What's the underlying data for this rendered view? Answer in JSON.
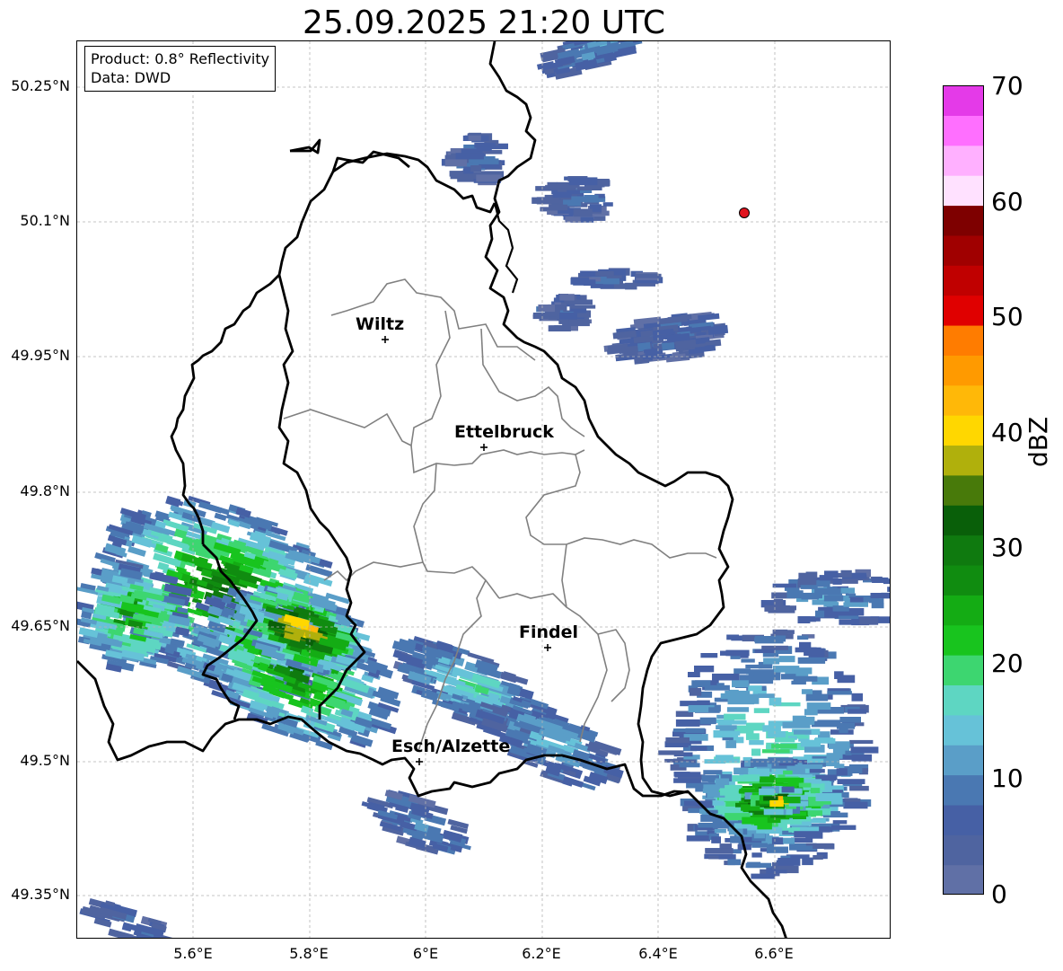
{
  "title": "25.09.2025 21:20 UTC",
  "info": {
    "product": "Product: 0.8° Reflectivity",
    "data": "Data: DWD"
  },
  "lat_ticks": [
    "50.25°N",
    "50.1°N",
    "49.95°N",
    "49.8°N",
    "49.65°N",
    "49.5°N",
    "49.35°N"
  ],
  "lon_ticks": [
    "5.6°E",
    "5.8°E",
    "6°E",
    "6.2°E",
    "6.4°E",
    "6.6°E"
  ],
  "cities": [
    {
      "name": "Wiltz",
      "lon": 5.93,
      "lat": 49.966
    },
    {
      "name": "Ettelbruck",
      "lon": 6.1,
      "lat": 49.847
    },
    {
      "name": "Findel",
      "lon": 6.21,
      "lat": 49.627
    },
    {
      "name": "Esch/Alzette",
      "lon": 5.99,
      "lat": 49.499
    }
  ],
  "marker": {
    "lon": 6.55,
    "lat": 50.11,
    "color": "#e0141e"
  },
  "colorbar": {
    "label": "dBZ",
    "ticks": [
      "0",
      "10",
      "20",
      "30",
      "40",
      "50",
      "60",
      "70"
    ],
    "min": 0,
    "max": 70,
    "step": 5,
    "colors": [
      "#6070a6",
      "#4f64a0",
      "#4660a5",
      "#4a78b2",
      "#5a9ec8",
      "#66c2d8",
      "#5ed6c2",
      "#3dd670",
      "#18c41e",
      "#14ac14",
      "#108c10",
      "#0f7a0f",
      "#095f09",
      "#487a0a",
      "#b0b00c",
      "#ffd700",
      "#ffb808",
      "#ff9a00",
      "#ff7c00",
      "#e00000",
      "#c00000",
      "#a00000",
      "#7e0000",
      "#ffe1ff",
      "#ffb0ff",
      "#ff6fff",
      "#e43ae8"
    ]
  },
  "colors": {
    "country_border": "#000000",
    "canton_border": "#808080",
    "grid": "#b4b4b4"
  }
}
